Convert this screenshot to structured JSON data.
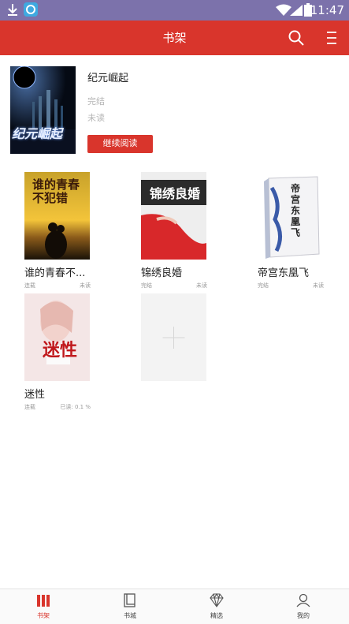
{
  "status_bar": {
    "time": "11:47",
    "icons": [
      "download-icon",
      "app-notification-icon",
      "wifi-icon",
      "signal-icon",
      "battery-icon"
    ]
  },
  "header": {
    "title": "书架",
    "search_icon": "search-icon",
    "menu_icon": "menu-icon"
  },
  "featured": {
    "title": "纪元崛起",
    "status": "完结",
    "read_status": "未读",
    "button_label": "继续阅读",
    "cover_text": "纪元崛起"
  },
  "books": [
    {
      "title": "谁的青春不...",
      "status": "连载",
      "progress": "未读",
      "cover_text": "谁的青春不犯错"
    },
    {
      "title": "锦绣良婚",
      "status": "完结",
      "progress": "未读",
      "cover_text": "锦绣良婚"
    },
    {
      "title": "帝宫东凰飞",
      "status": "完结",
      "progress": "未读",
      "cover_text": "帝宫东凰飞"
    },
    {
      "title": "迷性",
      "status": "连载",
      "progress": "已读: 0.1 %",
      "cover_text": "迷性"
    }
  ],
  "add_slot_icon": "plus-icon",
  "colors": {
    "accent": "#d9352c",
    "status_bar": "#7c72ab"
  },
  "bottom_nav": [
    {
      "label": "书架",
      "icon": "bookshelf-icon",
      "active": true
    },
    {
      "label": "书城",
      "icon": "book-icon",
      "active": false
    },
    {
      "label": "精选",
      "icon": "diamond-icon",
      "active": false
    },
    {
      "label": "我的",
      "icon": "user-icon",
      "active": false
    }
  ]
}
